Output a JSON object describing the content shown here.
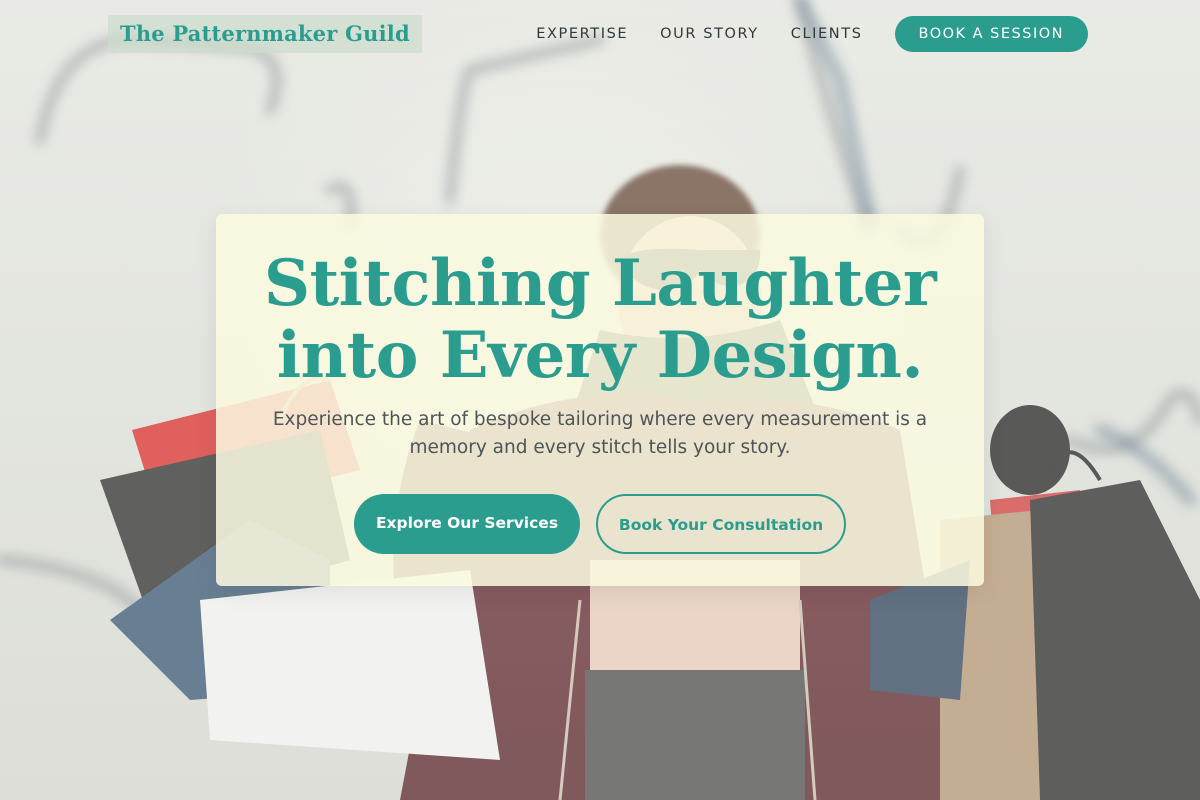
{
  "brand": {
    "name": "The Patternmaker Guild",
    "accent_color": "#2a9d8f"
  },
  "nav": {
    "links": [
      "EXPERTISE",
      "OUR STORY",
      "CLIENTS"
    ],
    "cta_label": "BOOK A SESSION"
  },
  "hero": {
    "title_line1": "Stitching Laughter",
    "title_line2": "into Every Design.",
    "subtitle_line1": "Experience the art of bespoke tailoring where every measurement is a",
    "subtitle_line2": "memory and every stitch tells your story.",
    "primary_button": "Explore Our Services",
    "secondary_button": "Book Your Consultation",
    "card_color": "#faf9e0"
  },
  "background": {
    "image_subject": "woman-with-shopping-bags-photo"
  }
}
